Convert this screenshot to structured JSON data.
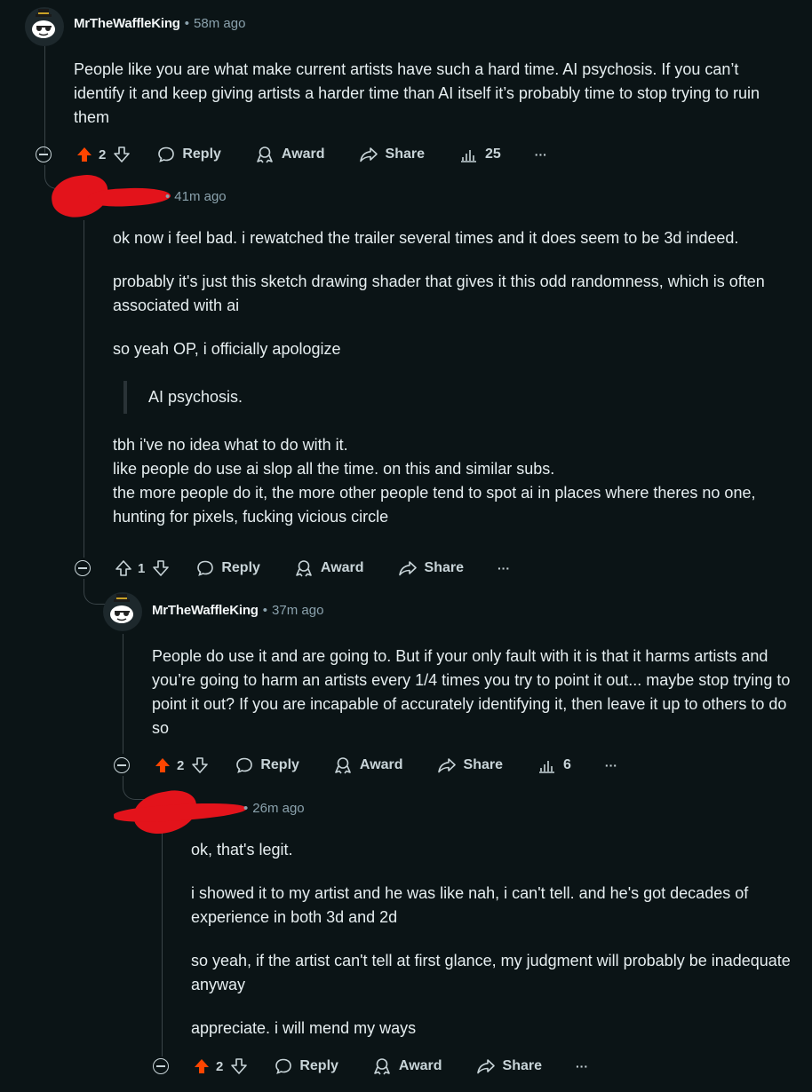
{
  "comments": [
    {
      "username": "MrTheWaffleKing",
      "time": "58m ago",
      "body": [
        "People like you are what make current artists have such a hard time. AI psychosis. If you can’t identify it and keep giving artists a harder time than AI itself it’s probably time to stop trying to ruin them"
      ],
      "votes": "2",
      "upvoted": true,
      "views": "25"
    },
    {
      "time": "41m ago",
      "body": [
        "ok now i feel bad. i rewatched the trailer several times and it does seem to be 3d indeed.",
        "probably it's just this sketch drawing shader that gives it this odd randomness, which is often associated with ai",
        "so yeah OP, i officially apologize"
      ],
      "quote": "AI psychosis.",
      "body_after": [
        "tbh i've no idea what to do with it.",
        "like people do use ai slop all the time. on this and similar subs.",
        "the more people do it, the more other people tend to spot ai in places where theres no one, hunting for pixels, fucking vicious circle"
      ],
      "votes": "1",
      "upvoted": false
    },
    {
      "username": "MrTheWaffleKing",
      "time": "37m ago",
      "body": [
        "People do use it and are going to. But if your only fault with it is that it harms artists and you’re going to harm an artists every 1/4 times you try to point it out... maybe stop trying to point it out? If you are incapable of accurately identifying it, then leave it up to others to do so"
      ],
      "votes": "2",
      "upvoted": true,
      "views": "6"
    },
    {
      "time": "26m ago",
      "body": [
        "ok, that's legit.",
        "i showed it to my artist and he was like nah, i can't tell. and he's got decades of experience in both 3d and 2d",
        "so yeah, if the artist can't tell at first glance, my judgment will probably be inadequate anyway",
        "appreciate. i will mend my ways"
      ],
      "votes": "2",
      "upvoted": true
    }
  ],
  "labels": {
    "reply": "Reply",
    "award": "Award",
    "share": "Share",
    "more": "···",
    "separator": "•"
  },
  "colors": {
    "background": "#0b1416",
    "upvote_active": "#ff4500",
    "text_muted": "#8ba2ad",
    "redaction": "#e3131b"
  }
}
